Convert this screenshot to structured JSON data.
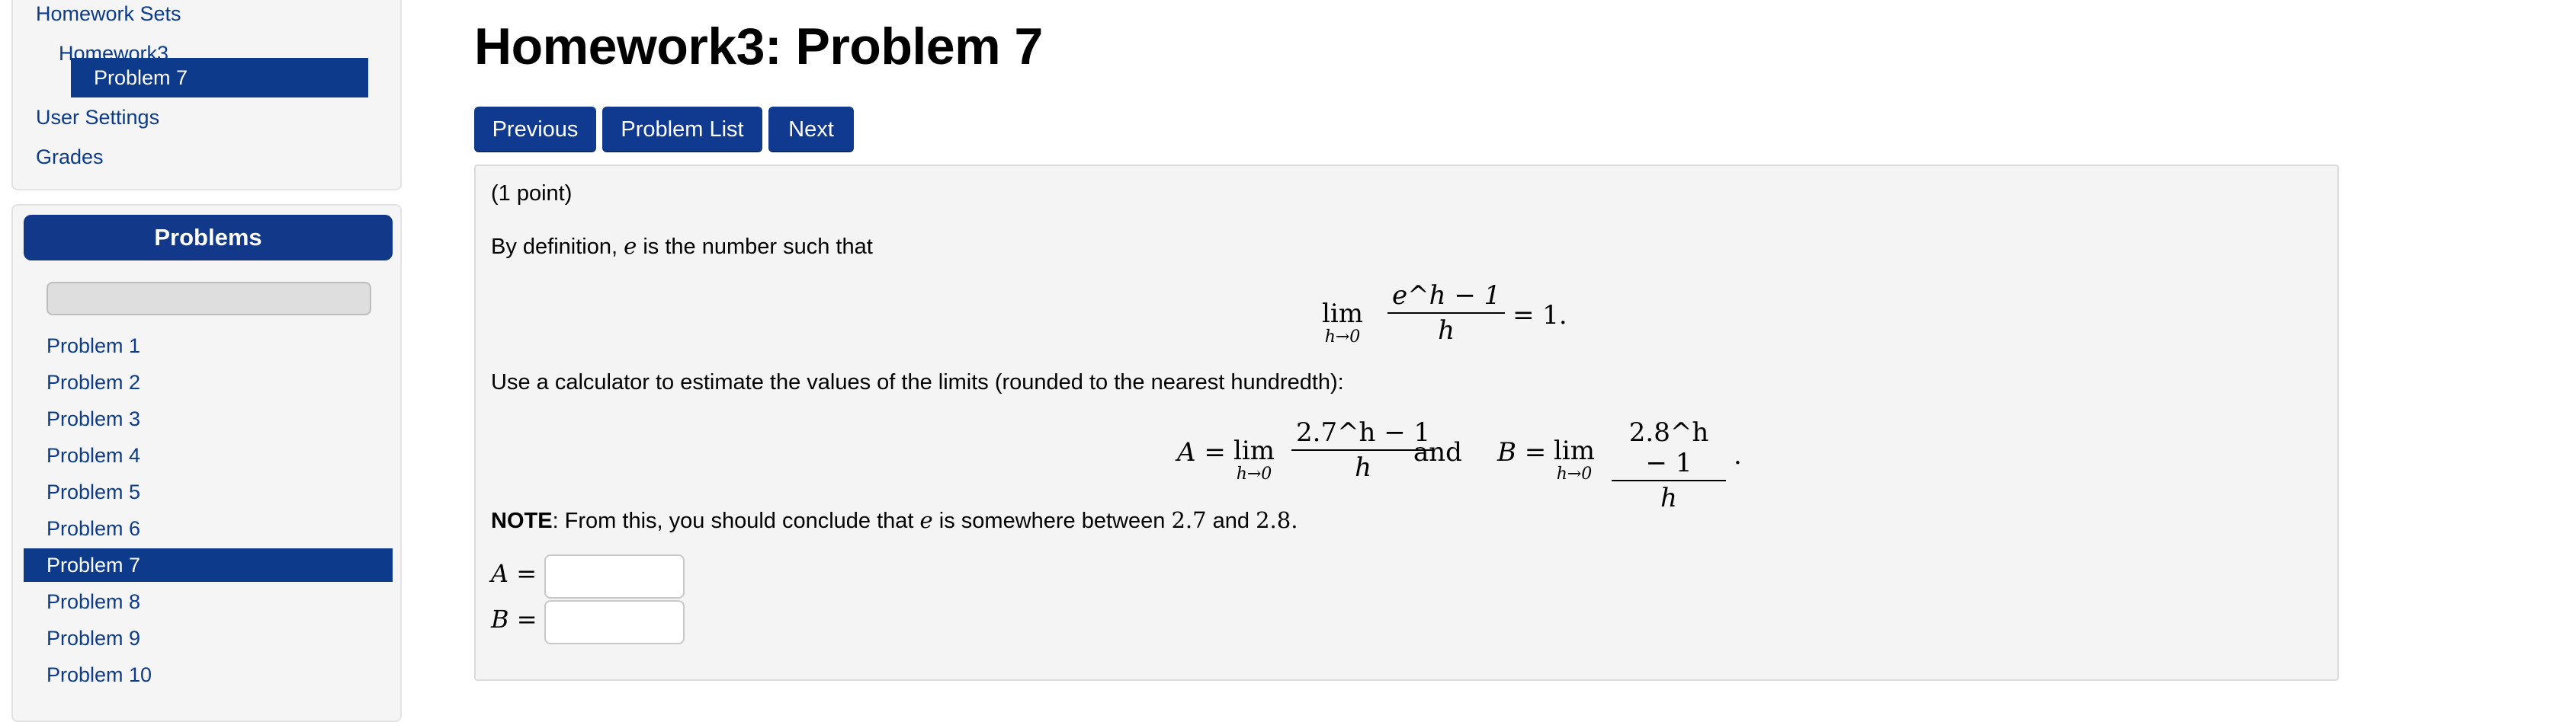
{
  "sidebar": {
    "nav": {
      "homework_sets": "Homework Sets",
      "homework": "Homework3",
      "problem": "Problem 7",
      "user_settings": "User Settings",
      "grades": "Grades"
    },
    "problems_panel": {
      "title": "Problems",
      "items": [
        "Problem 1",
        "Problem 2",
        "Problem 3",
        "Problem 4",
        "Problem 5",
        "Problem 6",
        "Problem 7",
        "Problem 8",
        "Problem 9",
        "Problem 10"
      ],
      "active_index": 6
    }
  },
  "main": {
    "title": "Homework3: Problem 7",
    "buttons": {
      "previous": "Previous",
      "problem_list": "Problem List",
      "next": "Next"
    },
    "problem": {
      "points": "(1 point)",
      "intro_before": "By definition,",
      "e_symbol": "e",
      "intro_after": "is the number such that",
      "limit_eq": {
        "lim": "lim",
        "sub": "h→0",
        "num": "e^h − 1",
        "den": "h",
        "rhs": "= 1."
      },
      "instruction": "Use a calculator to estimate the values of the limits (rounded to the nearest hundredth):",
      "limits": {
        "a_label": "A = ",
        "b_label": "B = ",
        "lim": "lim",
        "sub": "h→0",
        "a_num": "2.7^h − 1",
        "b_num": "2.8^h − 1",
        "den": "h",
        "and": "and",
        "period": "."
      },
      "note_label": "NOTE",
      "note_text": ": From this, you should conclude that",
      "note_e": "e",
      "note_mid": "is somewhere between",
      "note_low": "2.7",
      "note_and": "and",
      "note_high": "2.8.",
      "answer_a_label": "A =",
      "answer_b_label": "B =",
      "answer_a_value": "",
      "answer_b_value": ""
    }
  },
  "colors": {
    "accent": "#0e3a8c",
    "link": "#0b3b8c",
    "panel_bg": "#f5f5f5"
  }
}
